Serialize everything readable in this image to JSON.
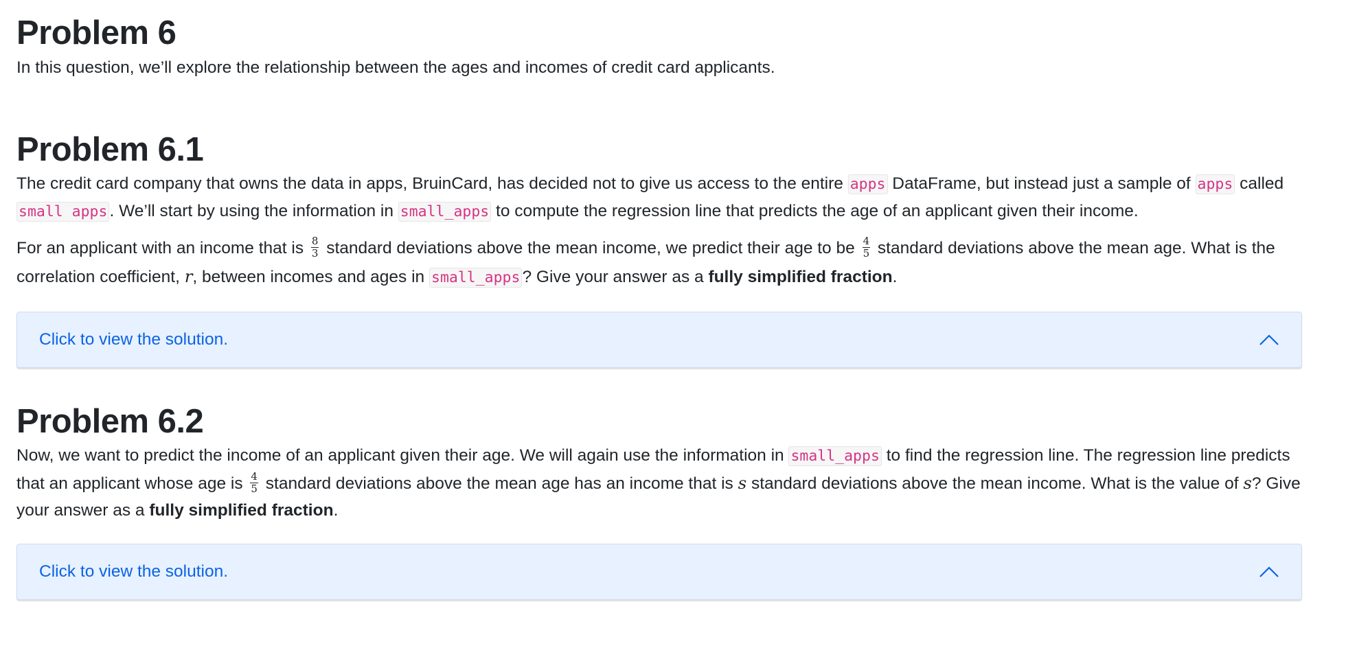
{
  "problem6": {
    "title": "Problem 6",
    "intro": "In this question, we’ll explore the relationship between the ages and incomes of credit card applicants."
  },
  "problem6_1": {
    "title": "Problem 6.1",
    "p1_a": "The credit card company that owns the data in apps, BruinCard, has decided not to give us access to the entire ",
    "code_apps_1": "apps",
    "p1_b": " DataFrame, but instead just a sample of ",
    "code_apps_2": "apps",
    "p1_c": " called ",
    "code_small_apps_1": "small apps",
    "p1_d": ". We’ll start by using the information in ",
    "code_small_apps_2": "small_apps",
    "p1_e": " to compute the regression line that predicts the age of an applicant given their income.",
    "p2_a": "For an applicant with an income that is ",
    "frac1_num": "8",
    "frac1_den": "3",
    "p2_b": " standard deviations above the mean income, we predict their age to be ",
    "frac2_num": "4",
    "frac2_den": "5",
    "p2_c": " standard deviations above the mean age. What is the correlation coefficient, ",
    "var_r": "r",
    "p2_d": ", between incomes and ages in ",
    "code_small_apps_3": "small_apps",
    "p2_e": "? Give your answer as a ",
    "bold": "fully simplified fraction",
    "p2_f": ".",
    "solution_label": "Click to view the solution."
  },
  "problem6_2": {
    "title": "Problem 6.2",
    "p1_a": "Now, we want to predict the income of an applicant given their age. We will again use the information in ",
    "code_small_apps": "small_apps",
    "p1_b": " to find the regression line. The regression line predicts that an applicant whose age is ",
    "frac_num": "4",
    "frac_den": "5",
    "p1_c": " standard deviations above the mean age has an income that is ",
    "var_s1": "s",
    "p1_d": " standard deviations above the mean income. What is the value of ",
    "var_s2": "s",
    "p1_e": "? Give your answer as a ",
    "bold": "fully simplified fraction",
    "p1_f": ".",
    "solution_label": "Click to view the solution."
  },
  "icons": {
    "solution_toggle": "chevron-up-icon"
  },
  "colors": {
    "code_text": "#d63384",
    "solution_bg": "#e7f1ff",
    "solution_text": "#0c63e4"
  }
}
